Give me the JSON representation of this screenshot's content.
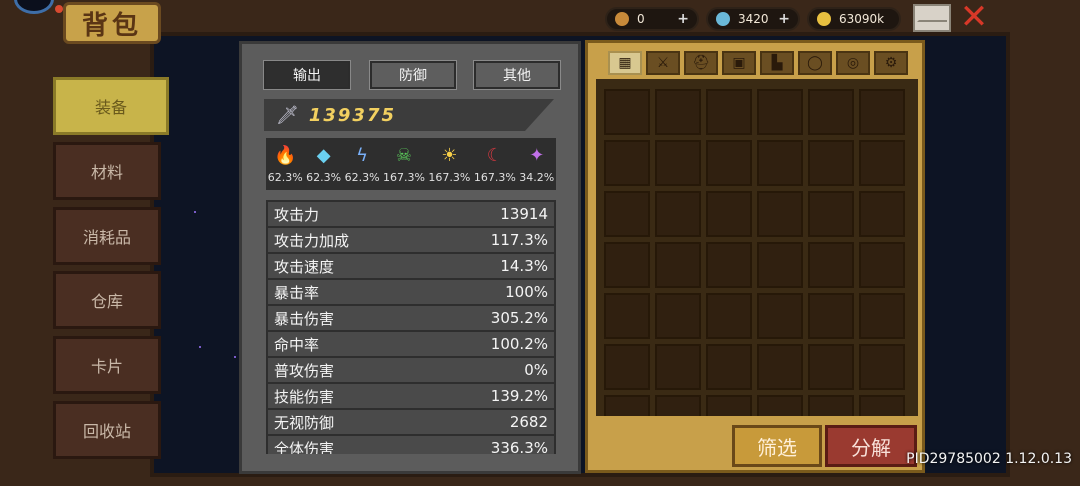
{
  "title": "背包",
  "currencies": [
    {
      "name": "bottle-icon",
      "value": "0",
      "color": "#c88a3a"
    },
    {
      "name": "gem-icon",
      "value": "3420",
      "color": "#6ab8d8"
    },
    {
      "name": "gold-coin-icon",
      "value": "63090k",
      "color": "#e8c040"
    }
  ],
  "left_tabs": [
    "装备",
    "材料",
    "消耗品",
    "仓库",
    "卡片",
    "回收站"
  ],
  "active_left_tab": 0,
  "stat_tabs": [
    "输出",
    "防御",
    "其他"
  ],
  "active_stat_tab": 0,
  "power": "139375",
  "elements": [
    {
      "name": "fire-icon",
      "glyph": "🔥",
      "color": "#f08a20",
      "pct": "62.3%"
    },
    {
      "name": "ice-crystal-icon",
      "glyph": "◆",
      "color": "#6ad0f0",
      "pct": "62.3%"
    },
    {
      "name": "lightning-icon",
      "glyph": "ϟ",
      "color": "#7ab0f8",
      "pct": "62.3%"
    },
    {
      "name": "poison-skull-icon",
      "glyph": "☠",
      "color": "#5ac85a",
      "pct": "167.3%"
    },
    {
      "name": "light-sun-icon",
      "glyph": "☀",
      "color": "#f8d048",
      "pct": "167.3%"
    },
    {
      "name": "dark-moon-icon",
      "glyph": "☾",
      "color": "#d03840",
      "pct": "167.3%"
    },
    {
      "name": "arcane-star-icon",
      "glyph": "✦",
      "color": "#c070e8",
      "pct": "34.2%"
    }
  ],
  "stats": [
    {
      "label": "攻击力",
      "value": "13914"
    },
    {
      "label": "攻击力加成",
      "value": "117.3%"
    },
    {
      "label": "攻击速度",
      "value": "14.3%"
    },
    {
      "label": "暴击率",
      "value": "100%"
    },
    {
      "label": "暴击伤害",
      "value": "305.2%"
    },
    {
      "label": "命中率",
      "value": "100.2%"
    },
    {
      "label": "普攻伤害",
      "value": "0%"
    },
    {
      "label": "技能伤害",
      "value": "139.2%"
    },
    {
      "label": "无视防御",
      "value": "2682"
    },
    {
      "label": "全体伤害",
      "value": "336.3%"
    }
  ],
  "inventory_categories": [
    {
      "name": "all-grid-icon",
      "glyph": "▦"
    },
    {
      "name": "weapon-sword-icon",
      "glyph": "⚔"
    },
    {
      "name": "helmet-icon",
      "glyph": "⛑"
    },
    {
      "name": "armor-icon",
      "glyph": "▣"
    },
    {
      "name": "boots-icon",
      "glyph": "▙"
    },
    {
      "name": "necklace-icon",
      "glyph": "◯"
    },
    {
      "name": "ring-icon",
      "glyph": "◎"
    },
    {
      "name": "gear-icon",
      "glyph": "⚙"
    }
  ],
  "filter_label": "筛选",
  "decompose_label": "分解",
  "pid": "PID29785002 1.12.0.13"
}
